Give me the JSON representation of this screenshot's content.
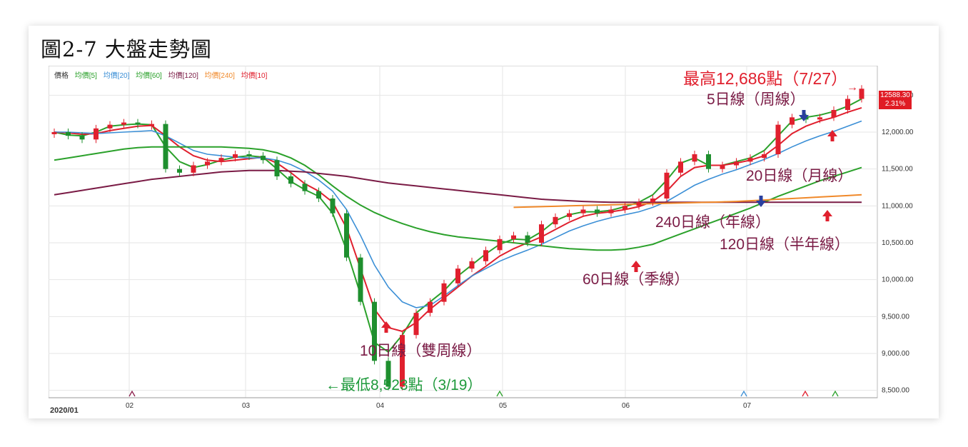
{
  "figure_title": "圖2-7 大盤走勢圖",
  "legend": [
    {
      "label": "價格",
      "color": "#333333"
    },
    {
      "label": "均價[5]",
      "color": "#2ba12b"
    },
    {
      "label": "均價[20]",
      "color": "#3b8fd6"
    },
    {
      "label": "均價[60]",
      "color": "#2ba12b"
    },
    {
      "label": "均價[120]",
      "color": "#7a1b45"
    },
    {
      "label": "均價[240]",
      "color": "#f0892a"
    },
    {
      "label": "均價[10]",
      "color": "#e0202e"
    }
  ],
  "price_badge": {
    "price": "12588.30",
    "change": "2.31%"
  },
  "annotations": {
    "high": "最高12,686點（7/27）",
    "ma5": "5日線（周線）",
    "ma20": "20日線（月線）",
    "ma240": "240日線（年線）",
    "ma120": "120日線（半年線）",
    "ma60": "60日線（季線）",
    "ma10": "10日線（雙周線）",
    "low": "←最低8,523點（3/19）",
    "high_arrow": "→"
  },
  "colors": {
    "up": "#e0202e",
    "down": "#1e8f2e",
    "arrow_red": "#e0202e",
    "arrow_blue": "#2a3f9e"
  },
  "chart_data": {
    "type": "line",
    "title": "",
    "x_start_label": "2020/01",
    "x_ticks": [
      "02",
      "03",
      "04",
      "05",
      "06",
      "07"
    ],
    "y_ticks": [
      "8,500.00",
      "9,000.00",
      "9,500.00",
      "10,000.00",
      "10,500.00",
      "11,000.00",
      "11,500.00",
      "12,000.00",
      "12,500.00"
    ],
    "ylim": [
      8400,
      12900
    ],
    "grid": true,
    "legend_position": "top-left",
    "series": [
      {
        "name": "價格",
        "color": "#333333",
        "values": [
          12000,
          11950,
          11900,
          12050,
          12100,
          12130,
          12100,
          12110,
          11500,
          11450,
          11550,
          11600,
          11650,
          11700,
          11680,
          11620,
          11400,
          11300,
          11200,
          11100,
          10900,
          10300,
          9700,
          8900,
          8550,
          9250,
          9550,
          9700,
          9950,
          10150,
          10250,
          10400,
          10550,
          10600,
          10500,
          10750,
          10850,
          10900,
          10950,
          10900,
          10950,
          11000,
          11050,
          11100,
          11450,
          11600,
          11700,
          11500,
          11550,
          11600,
          11650,
          11700,
          12100,
          12200,
          12180,
          12200,
          12300,
          12450,
          12588
        ]
      },
      {
        "name": "均價[5]",
        "color": "#2ba12b",
        "values": [
          12000,
          11960,
          11950,
          12000,
          12080,
          12100,
          12110,
          12100,
          11800,
          11600,
          11520,
          11560,
          11620,
          11660,
          11680,
          11660,
          11500,
          11330,
          11220,
          11130,
          10900,
          10400,
          9800,
          9150,
          9020,
          9250,
          9550,
          9700,
          9850,
          10050,
          10200,
          10350,
          10480,
          10550,
          10540,
          10650,
          10800,
          10880,
          10920,
          10920,
          10940,
          10990,
          11050,
          11150,
          11350,
          11580,
          11650,
          11550,
          11550,
          11600,
          11650,
          11750,
          11950,
          12150,
          12200,
          12230,
          12280,
          12350,
          12450
        ]
      },
      {
        "name": "均價[10]",
        "color": "#e0202e",
        "values": [
          12000,
          11990,
          11970,
          11980,
          12020,
          12050,
          12080,
          12090,
          11950,
          11800,
          11680,
          11620,
          11600,
          11620,
          11640,
          11660,
          11580,
          11450,
          11300,
          11200,
          11050,
          10700,
          10150,
          9600,
          9350,
          9300,
          9420,
          9600,
          9750,
          9900,
          10050,
          10180,
          10320,
          10420,
          10500,
          10580,
          10680,
          10780,
          10860,
          10900,
          10920,
          10950,
          10990,
          11060,
          11200,
          11400,
          11520,
          11550,
          11550,
          11580,
          11620,
          11680,
          11820,
          11980,
          12080,
          12150,
          12200,
          12270,
          12330
        ]
      },
      {
        "name": "均價[20]",
        "color": "#3b8fd6",
        "values": [
          12000,
          12000,
          11990,
          11980,
          11990,
          12000,
          12010,
          12020,
          11950,
          11850,
          11750,
          11700,
          11680,
          11660,
          11650,
          11650,
          11620,
          11560,
          11470,
          11350,
          11200,
          10950,
          10600,
          10200,
          9900,
          9700,
          9620,
          9650,
          9780,
          9920,
          10050,
          10150,
          10250,
          10330,
          10400,
          10480,
          10570,
          10660,
          10730,
          10790,
          10840,
          10880,
          10920,
          10980,
          11060,
          11170,
          11280,
          11360,
          11430,
          11490,
          11560,
          11630,
          11710,
          11800,
          11880,
          11950,
          12010,
          12080,
          12150
        ]
      },
      {
        "name": "均價[60]",
        "color": "#2ba12b",
        "values": [
          11620,
          11650,
          11680,
          11710,
          11740,
          11770,
          11790,
          11800,
          11800,
          11800,
          11800,
          11800,
          11800,
          11790,
          11780,
          11760,
          11720,
          11650,
          11550,
          11420,
          11270,
          11130,
          11010,
          10910,
          10830,
          10760,
          10700,
          10650,
          10610,
          10580,
          10560,
          10540,
          10520,
          10500,
          10480,
          10460,
          10440,
          10420,
          10410,
          10400,
          10400,
          10410,
          10440,
          10480,
          10550,
          10620,
          10690,
          10760,
          10830,
          10900,
          10970,
          11050,
          11130,
          11200,
          11270,
          11340,
          11400,
          11460,
          11520
        ]
      },
      {
        "name": "均價[120]",
        "color": "#7a1b45",
        "values": [
          11150,
          11180,
          11210,
          11240,
          11270,
          11300,
          11330,
          11360,
          11380,
          11400,
          11420,
          11440,
          11460,
          11470,
          11480,
          11480,
          11480,
          11470,
          11460,
          11440,
          11420,
          11400,
          11370,
          11340,
          11310,
          11290,
          11270,
          11250,
          11230,
          11210,
          11190,
          11170,
          11150,
          11130,
          11110,
          11090,
          11080,
          11070,
          11060,
          11055,
          11050,
          11050,
          11050,
          11050,
          11050,
          11050,
          11050,
          11050,
          11050,
          11050,
          11050,
          11050,
          11050,
          11050,
          11050,
          11050,
          11050,
          11050,
          11050
        ]
      },
      {
        "name": "均價[240]",
        "color": "#f0892a",
        "values": [
          null,
          null,
          null,
          null,
          null,
          null,
          null,
          null,
          null,
          null,
          null,
          null,
          null,
          null,
          null,
          null,
          null,
          null,
          null,
          null,
          null,
          null,
          null,
          null,
          null,
          null,
          null,
          null,
          null,
          null,
          null,
          null,
          null,
          10980,
          10985,
          10990,
          10995,
          11000,
          11005,
          11010,
          11015,
          11020,
          11025,
          11030,
          11035,
          11040,
          11045,
          11050,
          11055,
          11060,
          11070,
          11080,
          11090,
          11100,
          11110,
          11120,
          11130,
          11140,
          11150
        ]
      }
    ]
  }
}
